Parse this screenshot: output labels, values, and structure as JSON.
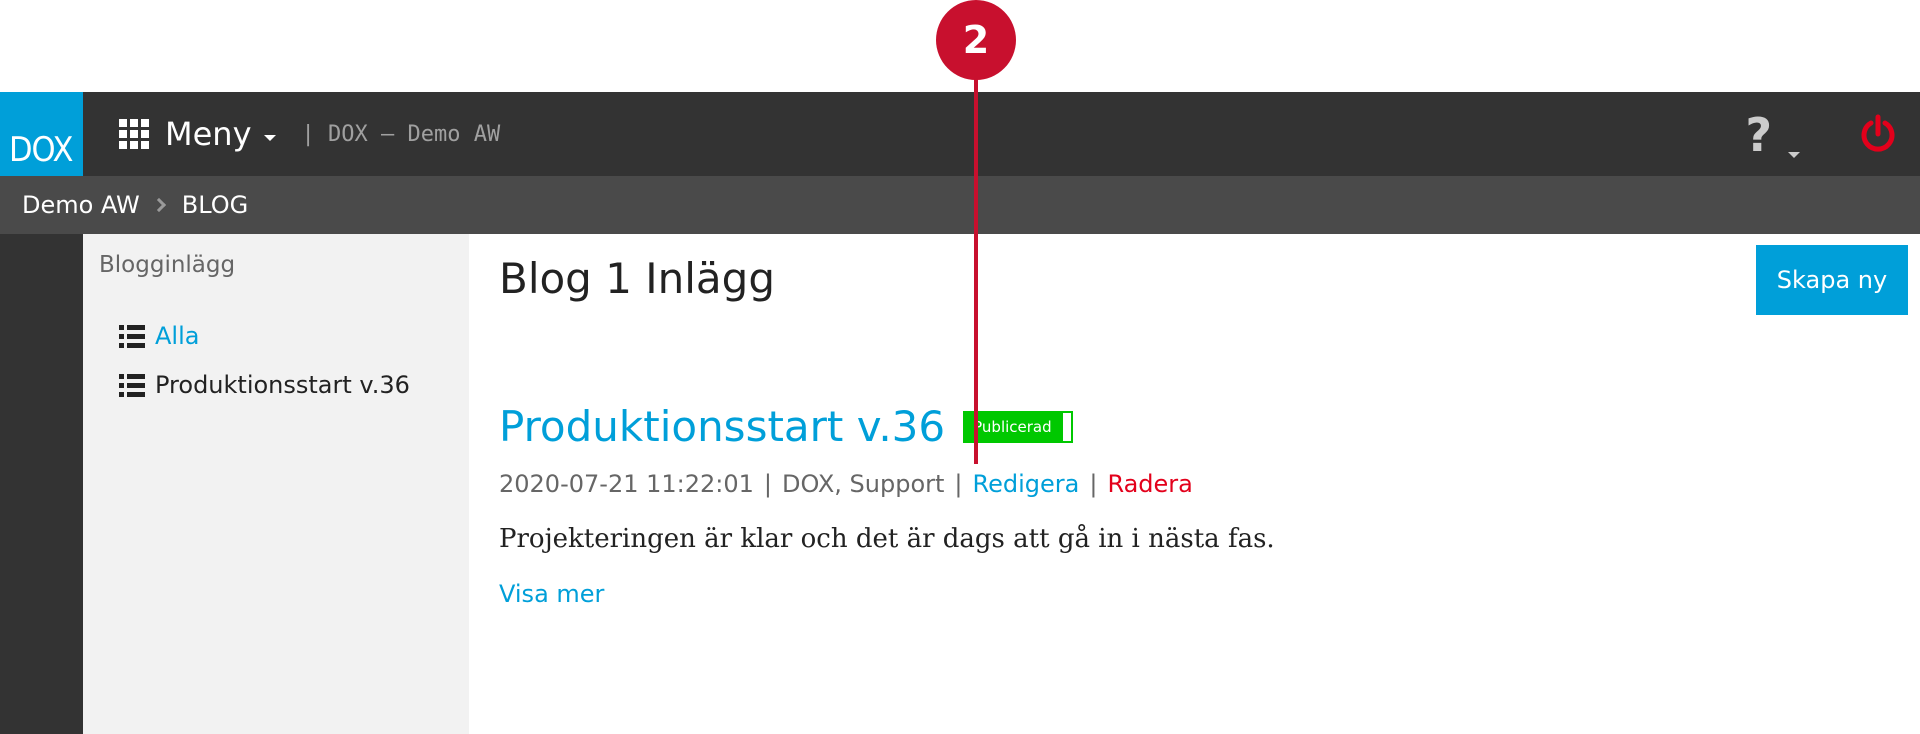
{
  "callout": {
    "number": "2"
  },
  "topbar": {
    "logo_text": "DOX",
    "menu_label": "Meny",
    "site_name": "| DOX – Demo AW",
    "help_label": "?"
  },
  "breadcrumb": {
    "items": [
      "Demo AW",
      "BLOG"
    ]
  },
  "sidebar": {
    "title": "Blogginlägg",
    "items": [
      {
        "label": "Alla",
        "active": true
      },
      {
        "label": "Produktionsstart v.36",
        "active": false
      }
    ]
  },
  "main": {
    "page_title": "Blog 1 Inlägg",
    "create_button": "Skapa ny",
    "post": {
      "title": "Produktionsstart v.36",
      "status_badge": "Publicerad",
      "timestamp": "2020-07-21 11:22:01",
      "author": "DOX, Support",
      "edit_label": "Redigera",
      "delete_label": "Radera",
      "excerpt": "Projekteringen är klar och det är dags att gå in i nästa fas.",
      "more_label": "Visa mer"
    }
  },
  "colors": {
    "accent": "#009fd9",
    "topbar": "#333333",
    "breadcrumb_bar": "#4a4a4a",
    "badge_green": "#00c800",
    "danger_red": "#e3001b",
    "callout_red": "#c8102e"
  },
  "icons": {
    "menu": "grid-icon",
    "help": "question-icon",
    "logout": "power-icon",
    "breadcrumb_sep": "chevron-right-icon",
    "list": "list-icon"
  }
}
